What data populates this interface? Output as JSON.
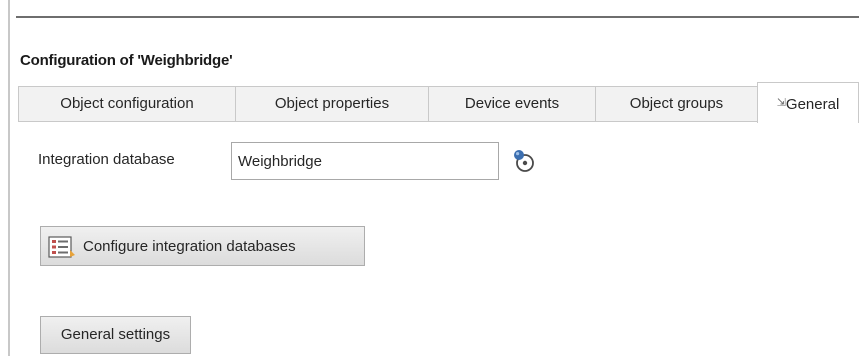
{
  "window": {
    "title": "Configuration of 'Weighbridge'"
  },
  "tabs": [
    {
      "label": "Object configuration",
      "active": false
    },
    {
      "label": "Object properties",
      "active": false
    },
    {
      "label": "Device events",
      "active": false
    },
    {
      "label": "Object groups",
      "active": false
    },
    {
      "label": "General",
      "active": true,
      "icon": "resize-arrow-icon"
    }
  ],
  "general": {
    "integration_database": {
      "label": "Integration database",
      "value": "Weighbridge",
      "action_icon": "select-icon"
    },
    "configure_button": {
      "label": "Configure integration databases",
      "icon": "database-list-icon"
    },
    "settings_button": {
      "label": "General settings"
    }
  },
  "colors": {
    "tab_background": "#f2f2f2",
    "border": "#c9c9c9",
    "text": "#262626",
    "icon_blue": "#3c6fb0"
  }
}
